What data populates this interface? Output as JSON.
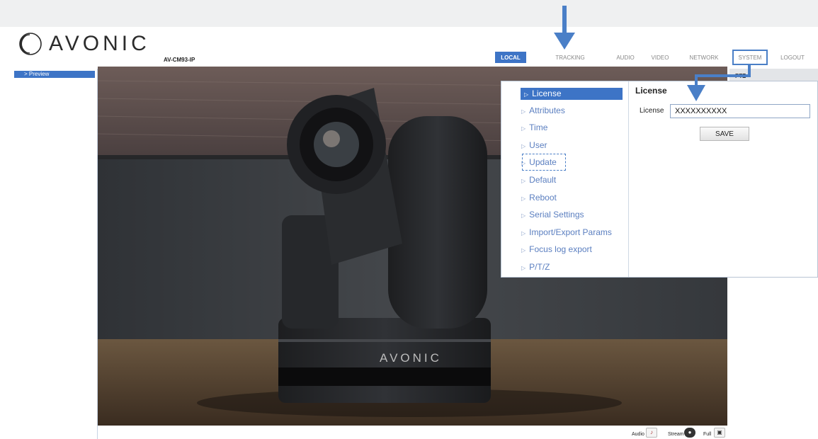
{
  "brand": {
    "logo_text": "AVONIC",
    "model": "AV-CM93-IP"
  },
  "nav": {
    "local": "LOCAL",
    "tracking": "TRACKING",
    "audio": "AUDIO",
    "video": "VIDEO",
    "network": "NETWORK",
    "system": "SYSTEM",
    "logout": "LOGOUT"
  },
  "sidebar": {
    "preview": "> Preview"
  },
  "right_panel": {
    "label": "PTZ"
  },
  "video": {
    "camera_brand": "AVONIC"
  },
  "system_menu": {
    "items": [
      {
        "label": "License",
        "active": true
      },
      {
        "label": "Attributes"
      },
      {
        "label": "Time"
      },
      {
        "label": "User"
      },
      {
        "label": "Update"
      },
      {
        "label": "Default"
      },
      {
        "label": "Reboot"
      },
      {
        "label": "Serial Settings"
      },
      {
        "label": "Import/Export Params"
      },
      {
        "label": "Focus log export"
      },
      {
        "label": "P/T/Z"
      }
    ]
  },
  "license": {
    "title": "License",
    "field_label": "License",
    "field_value": "XXXXXXXXXX",
    "save_label": "SAVE"
  },
  "bottom_bar": {
    "audio": "Audio",
    "stream": "Stream",
    "full": "Full"
  },
  "icons": {
    "audio": "speaker-muted-icon",
    "stream": "stream-icon",
    "full": "fullscreen-icon",
    "menu_arrow": "right-triangle-icon"
  },
  "colors": {
    "accent": "#3d74c6",
    "annotation": "#4a7fc7",
    "menu_link": "#5b7fc0"
  }
}
